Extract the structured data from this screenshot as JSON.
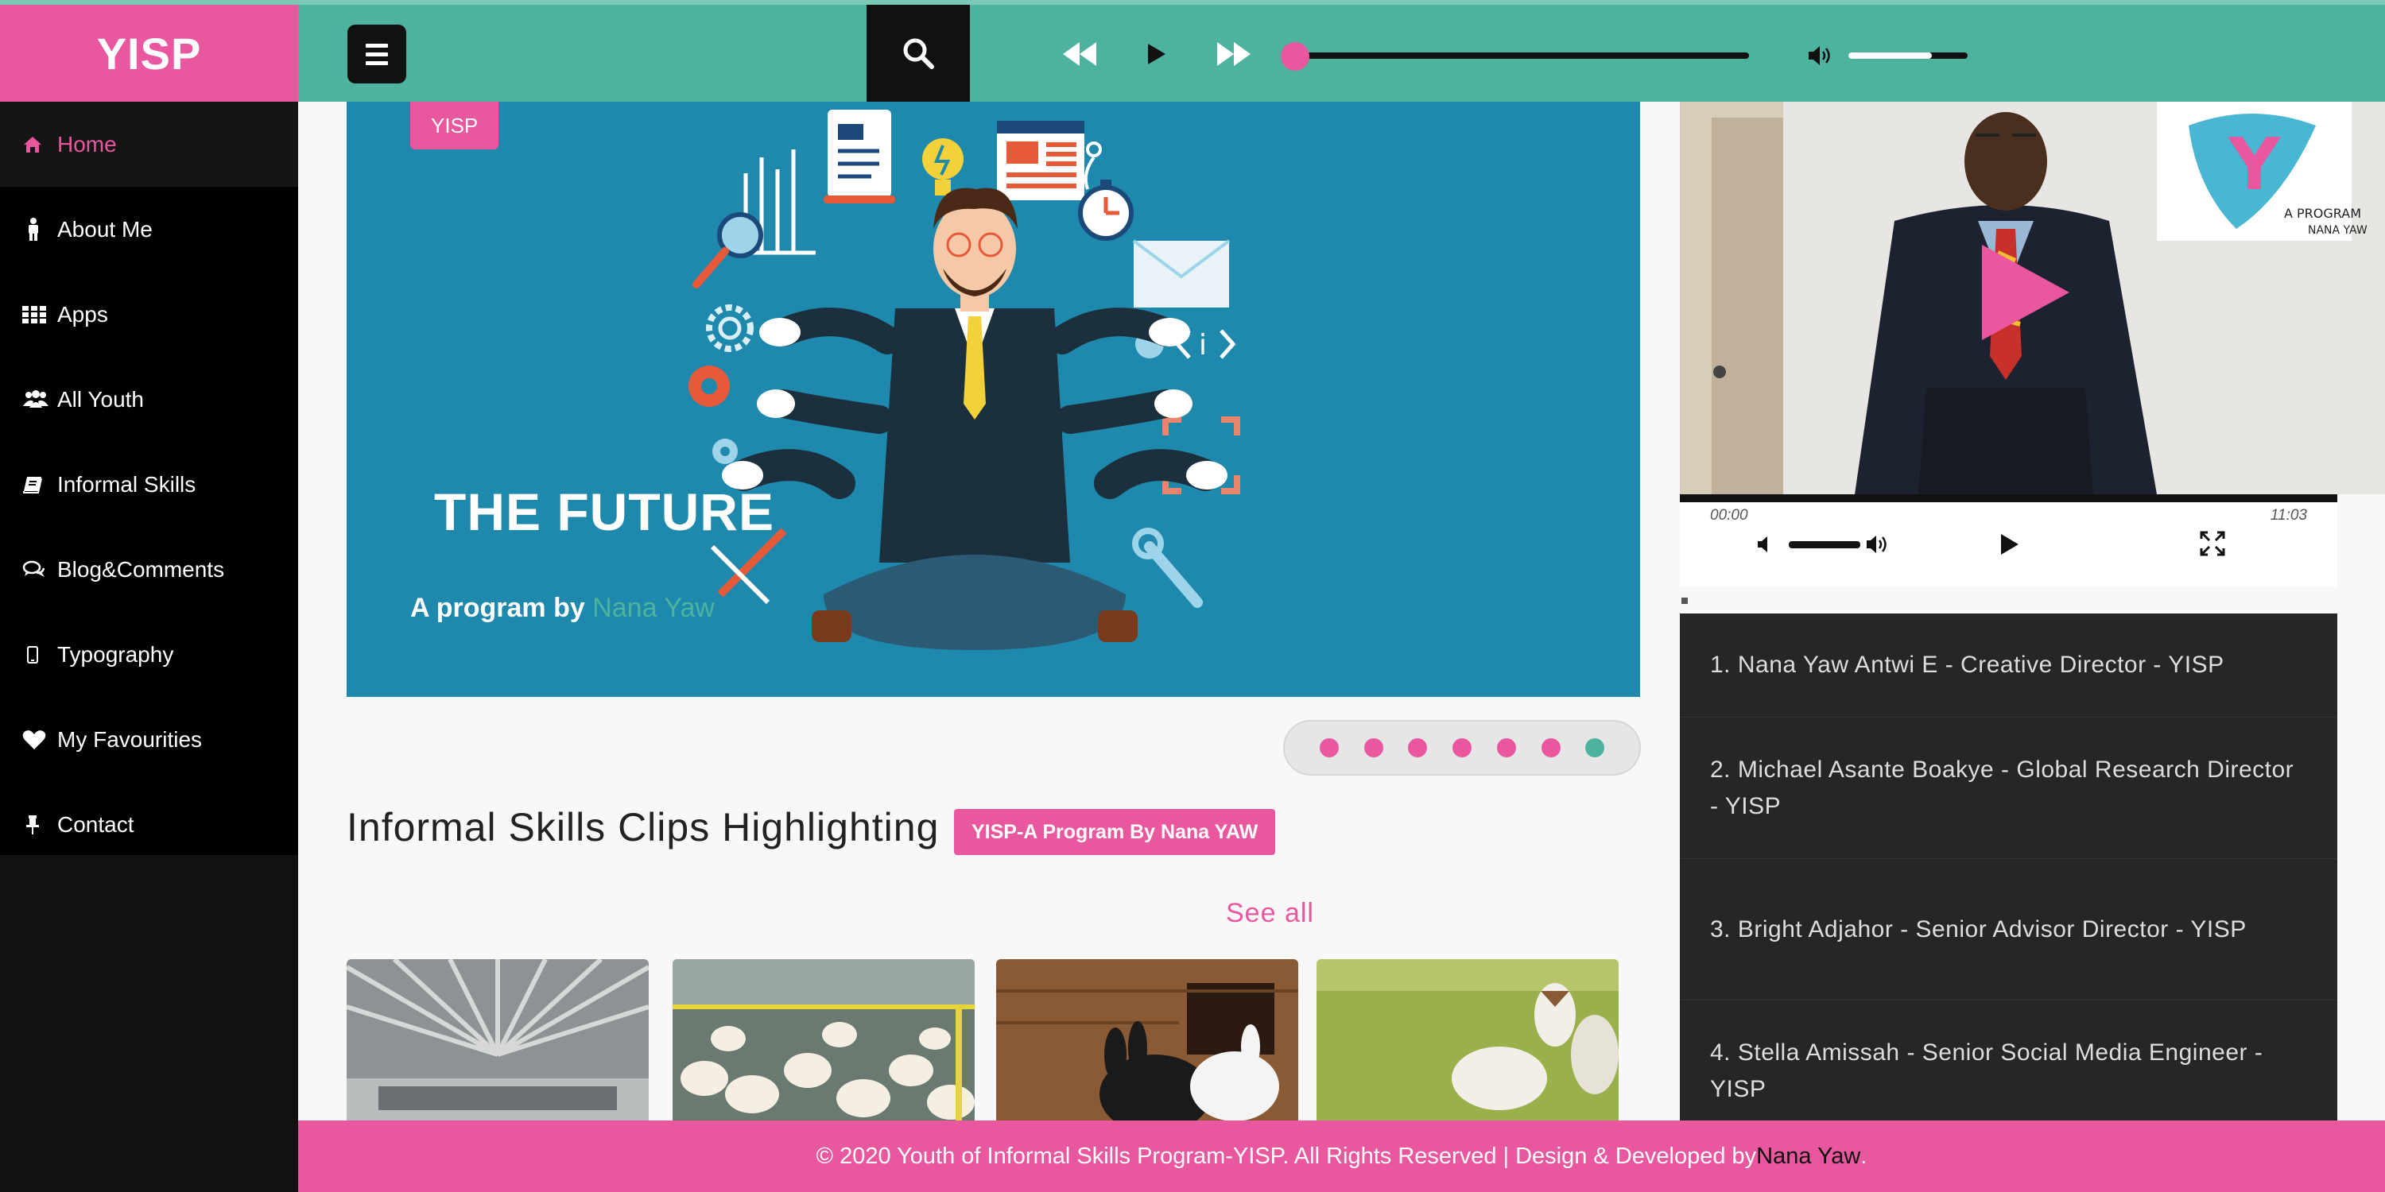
{
  "brand": {
    "logo": "YISP",
    "accent": "#e9579f",
    "teal": "#4db39e"
  },
  "sidebar": {
    "items": [
      {
        "label": "Home",
        "icon": "home-icon"
      },
      {
        "label": "About Me",
        "icon": "person-icon"
      },
      {
        "label": "Apps",
        "icon": "grid-icon"
      },
      {
        "label": "All Youth",
        "icon": "users-icon"
      },
      {
        "label": "Informal Skills",
        "icon": "book-icon"
      },
      {
        "label": "Blog&Comments",
        "icon": "comments-icon"
      },
      {
        "label": "Typography",
        "icon": "phone-icon"
      },
      {
        "label": "My Favourities",
        "icon": "heart-icon"
      },
      {
        "label": "Contact",
        "icon": "pin-icon"
      }
    ]
  },
  "player": {
    "progress": 0.0,
    "volume": 0.7
  },
  "hero": {
    "badge": "YISP",
    "title": "THE FUTURE",
    "subtitle_prefix": "A program by ",
    "subtitle_name": "Nana Yaw",
    "slides": 7,
    "current_slide": 7
  },
  "section": {
    "heading": "Informal Skills Clips Highlighting",
    "badge": "YISP-A Program By Nana YAW",
    "see_all": "See all"
  },
  "video": {
    "current_time": "00:00",
    "duration": "11:03",
    "volume": 0.6
  },
  "credits": [
    "1. Nana Yaw Antwi E - Creative Director - YISP",
    "2. Michael Asante Boakye - Global Research Director - YISP",
    "3. Bright Adjahor - Senior Advisor Director - YISP",
    "4. Stella Amissah - Senior Social Media Engineer - YISP"
  ],
  "footer": {
    "text": "© 2020 Youth of Informal Skills Program-YISP. All Rights Reserved | Design & Developed by ",
    "author": "Nana Yaw",
    "suffix": "."
  }
}
